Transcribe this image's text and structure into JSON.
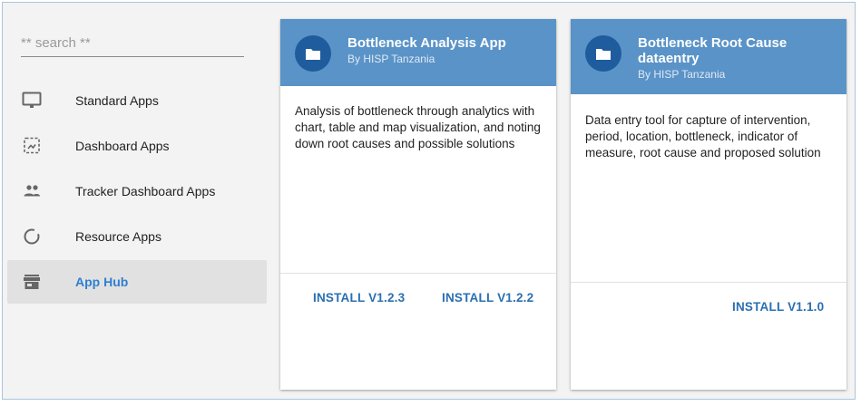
{
  "search": {
    "placeholder": "** search **"
  },
  "sidebar": {
    "items": [
      {
        "label": "Standard Apps",
        "icon": "monitor-icon"
      },
      {
        "label": "Dashboard Apps",
        "icon": "dashboard-icon"
      },
      {
        "label": "Tracker Dashboard Apps",
        "icon": "people-icon"
      },
      {
        "label": "Resource Apps",
        "icon": "donut-icon"
      },
      {
        "label": "App Hub",
        "icon": "store-icon",
        "active": true
      }
    ]
  },
  "cards": [
    {
      "title_line1": "Bottleneck Analysis App",
      "title_line2": "",
      "author": "By HISP Tanzania",
      "description": "Analysis of bottleneck through analytics with chart, table and map visualization, and noting down root causes and possible solutions",
      "installs": [
        "INSTALL V1.2.3",
        "INSTALL V1.2.2"
      ]
    },
    {
      "title_line1": "Bottleneck Root Cause",
      "title_line2": "dataentry",
      "author": "By HISP Tanzania",
      "description": "Data entry tool for capture of intervention, period, location, bottleneck, indicator of measure, root cause and proposed solution",
      "installs": [
        "INSTALL V1.1.0"
      ]
    }
  ],
  "colors": {
    "header": "#5a93c7",
    "avatar": "#1f5c9e",
    "accent": "#2f7fd1",
    "button": "#2a6fb1"
  }
}
